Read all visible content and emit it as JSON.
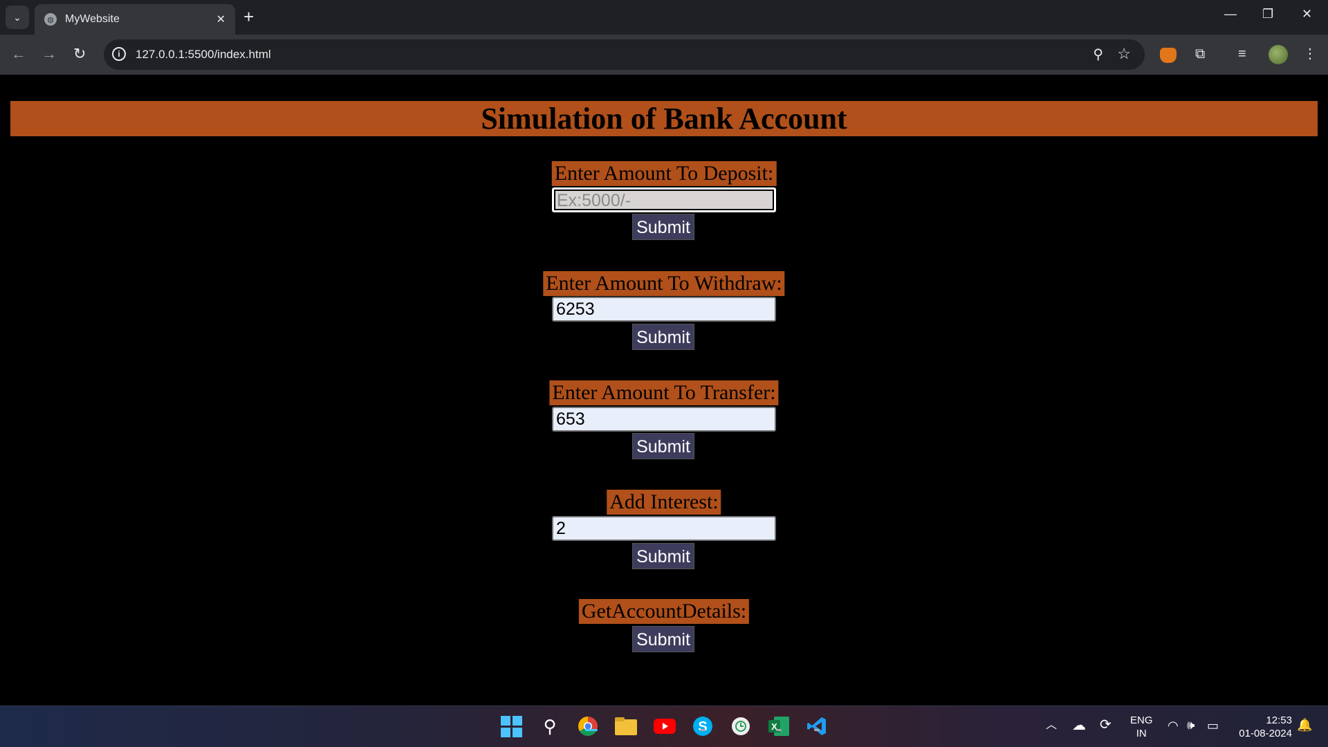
{
  "browser": {
    "tab_title": "MyWebsite",
    "url": "127.0.0.1:5500/index.html"
  },
  "page": {
    "title": "Simulation of Bank Account",
    "deposit": {
      "label": "Enter Amount To Deposit:",
      "placeholder": "Ex:5000/-",
      "value": "",
      "submit": "Submit"
    },
    "withdraw": {
      "label": "Enter Amount To Withdraw:",
      "value": "6253",
      "submit": "Submit"
    },
    "transfer": {
      "label": "Enter Amount To Transfer:",
      "value": "653",
      "submit": "Submit"
    },
    "interest": {
      "label": "Add Interest:",
      "value": "2",
      "submit": "Submit"
    },
    "details": {
      "label": "GetAccountDetails:",
      "submit": "Submit"
    }
  },
  "taskbar": {
    "lang": "ENG",
    "region": "IN",
    "time": "12:53",
    "date": "01-08-2024"
  }
}
